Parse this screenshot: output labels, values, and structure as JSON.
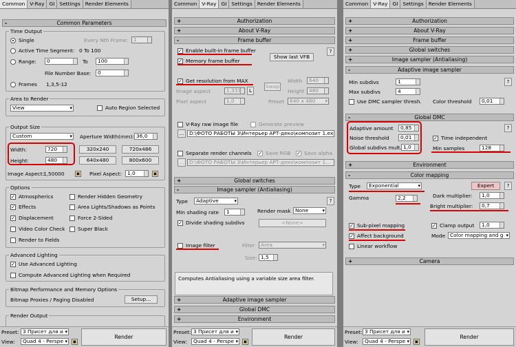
{
  "tabs": {
    "common": "Common",
    "vray": "V-Ray",
    "gi": "GI",
    "settings": "Settings",
    "render_elements": "Render Elements"
  },
  "panel1": {
    "rollout_title": "Common Parameters",
    "time_output": {
      "label": "Time Output",
      "single": "Single",
      "every_nth": "Every Nth Frame:",
      "every_nth_value": "1",
      "active_segment": "Active Time Segment:",
      "active_range": "0 To 100",
      "range": "Range:",
      "range_from": "0",
      "to": "To",
      "range_to": "100",
      "file_number_base": "File Number Base:",
      "file_number_value": "0",
      "frames": "Frames",
      "frames_value": "1,3,5-12"
    },
    "area": {
      "label": "Area to Render",
      "view": "View",
      "auto_region": "Auto Region Selected"
    },
    "output_size": {
      "label": "Output Size",
      "preset": "Custom",
      "aperture": "Aperture Width(mm):",
      "aperture_value": "36,0",
      "width_label": "Width:",
      "width": "720",
      "height_label": "Height:",
      "height": "480",
      "size_buttons": [
        "320x240",
        "720x486",
        "640x480",
        "800x600"
      ],
      "image_aspect": "Image Aspect:",
      "image_aspect_value": "1,50000",
      "pixel_aspect": "Pixel Aspect:",
      "pixel_aspect_value": "1,0"
    },
    "options": {
      "label": "Options",
      "atmospherics": "Atmospherics",
      "render_hidden": "Render Hidden Geometry",
      "effects": "Effects",
      "area_lights": "Area Lights/Shadows as Points",
      "displacement": "Displacement",
      "force_2sided": "Force 2-Sided",
      "video_color": "Video Color Check",
      "super_black": "Super Black",
      "render_fields": "Render to Fields"
    },
    "adv_lighting": {
      "label": "Advanced Lighting",
      "use": "Use Advanced Lighting",
      "compute": "Compute Advanced Lighting when Required"
    },
    "bitmap": {
      "label": "Bitmap Performance and Memory Options",
      "proxies": "Bitmap Proxies / Paging Disabled",
      "setup": "Setup..."
    },
    "render_output": "Render Output"
  },
  "panel2": {
    "authorization": "Authorization",
    "about": "About V-Ray",
    "frame_buffer": "Frame buffer",
    "help": "?",
    "enable_vfb": "Enable built-in frame buffer",
    "memory_fb": "Memory frame buffer",
    "show_last_vfb": "Show last VFB",
    "get_res": "Get resolution from MAX",
    "width_label": "Width",
    "width": "640",
    "height_label": "Height",
    "height": "480",
    "swap": "Swap",
    "image_aspect": "Image aspect",
    "image_aspect_value": "1,333",
    "lock": "L",
    "pixel_aspect": "Pixel aspect",
    "pixel_aspect_value": "1,0",
    "preset_label": "Preset",
    "preset_value": "640 x 480",
    "raw_file": "V-Ray raw image file",
    "generate_preview": "Generate preview",
    "raw_path": "D:\\ФОТО РАБОТЫ 3\\Интерьер АРТ-деко\\композит 1.exr",
    "separate_channels": "Separate render channels",
    "save_rgb": "Save RGB",
    "save_alpha": "Save alpha",
    "channels_path": "D:\\ФОТО РАБОТЫ 3\\Интерьер АРТ-деко\\композит 1...",
    "global_switches": "Global switches",
    "image_sampler_title": "Image sampler (Antialiasing)",
    "type_label": "Type",
    "type_value": "Adaptive",
    "min_shading_label": "Min shading rate",
    "min_shading_value": "1",
    "render_mask_label": "Render mask",
    "render_mask_value": "None",
    "divide_shading": "Divide shading subdivs",
    "none_btn": "<None>",
    "image_filter": "Image filter",
    "filter_label": "Filter",
    "filter_value": "Area",
    "size_label": "Size:",
    "size_value": "1,5",
    "filter_hint": "Computes Antialiasing using a variable size area filter.",
    "adaptive_sampler": "Adaptive image sampler",
    "global_dmc": "Global DMC",
    "environment": "Environment"
  },
  "panel3": {
    "authorization": "Authorization",
    "about": "About V-Ray",
    "frame_buffer": "Frame buffer",
    "global_switches": "Global switches",
    "image_sampler": "Image sampler (Antialiasing)",
    "adaptive_sampler": "Adaptive image sampler",
    "min_subdivs_label": "Min subdivs",
    "min_subdivs": "1",
    "max_subdivs_label": "Max subdivs",
    "max_subdivs": "4",
    "use_dmc": "Use DMC sampler thresh.",
    "color_threshold_label": "Color threshold",
    "color_threshold": "0,01",
    "global_dmc_title": "Global DMC",
    "adaptive_amount_label": "Adaptive amount",
    "adaptive_amount": "0,85",
    "time_independent": "Time independent",
    "noise_threshold_label": "Noise threshold",
    "noise_threshold": "0,01",
    "global_subdivs_label": "Global subdivs mult.",
    "global_subdivs": "1,0",
    "min_samples_label": "Min samples",
    "min_samples": "128",
    "help": "?",
    "environment": "Environment",
    "color_mapping_title": "Color mapping",
    "type_label": "Type",
    "type_value": "Exponential",
    "expert": "Expert",
    "dark_mult_label": "Dark multiplier:",
    "dark_mult": "1,0",
    "gamma_label": "Gamma",
    "gamma": "2,2",
    "bright_mult_label": "Bright multiplier:",
    "bright_mult": "0,7",
    "sub_pixel": "Sub-pixel mapping",
    "clamp_output": "Clamp output",
    "clamp_value": "1,0",
    "affect_bg": "Affect background",
    "mode_label": "Mode",
    "mode_value": "Color mapping and g",
    "linear_workflow": "Linear workflow",
    "camera": "Camera"
  },
  "bottom": {
    "preset_label": "Preset:",
    "preset_value": "3 Присет для и",
    "view_label": "View:",
    "view_value": "Quad 4 - Perspe",
    "render": "Render"
  },
  "colors": {
    "panel": "#d4d4d4",
    "highlight": "#d90000",
    "separator": "#7d7d7d"
  }
}
